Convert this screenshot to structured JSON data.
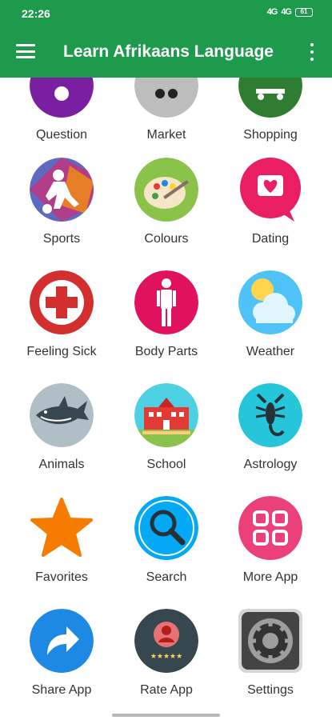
{
  "status_bar": {
    "time": "22:26",
    "signal_1": "4G",
    "signal_2": "4G",
    "battery": "61"
  },
  "app_bar": {
    "title": "Learn Afrikaans Language"
  },
  "tiles": [
    {
      "label": "Question",
      "icon": "question-icon",
      "color": "#7b1fa2"
    },
    {
      "label": "Market",
      "icon": "market-icon",
      "color": "#9e9e9e"
    },
    {
      "label": "Shopping",
      "icon": "shopping-cart-icon",
      "color": "#2e7d32"
    },
    {
      "label": "Sports",
      "icon": "sports-icon",
      "color": "#3f51b5"
    },
    {
      "label": "Colours",
      "icon": "palette-icon",
      "color": "#8bc34a"
    },
    {
      "label": "Dating",
      "icon": "heart-chat-icon",
      "color": "#e91e63"
    },
    {
      "label": "Feeling Sick",
      "icon": "medical-cross-icon",
      "color": "#d32f2f"
    },
    {
      "label": "Body Parts",
      "icon": "body-icon",
      "color": "#e0115f"
    },
    {
      "label": "Weather",
      "icon": "weather-icon",
      "color": "#4fc3f7"
    },
    {
      "label": "Animals",
      "icon": "shark-icon",
      "color": "#b0bec5"
    },
    {
      "label": "School",
      "icon": "school-icon",
      "color": "#4dd0e1"
    },
    {
      "label": "Astrology",
      "icon": "scorpion-icon",
      "color": "#26c6da"
    },
    {
      "label": "Favorites",
      "icon": "star-icon",
      "color": "#f57c00"
    },
    {
      "label": "Search",
      "icon": "search-icon",
      "color": "#03a9f4"
    },
    {
      "label": "More App",
      "icon": "grid-icon",
      "color": "#ec407a"
    },
    {
      "label": "Share App",
      "icon": "share-icon",
      "color": "#1e88e5"
    },
    {
      "label": "Rate App",
      "icon": "rate-icon",
      "color": "#37474f"
    },
    {
      "label": "Settings",
      "icon": "gear-icon",
      "color": "#616161"
    }
  ]
}
